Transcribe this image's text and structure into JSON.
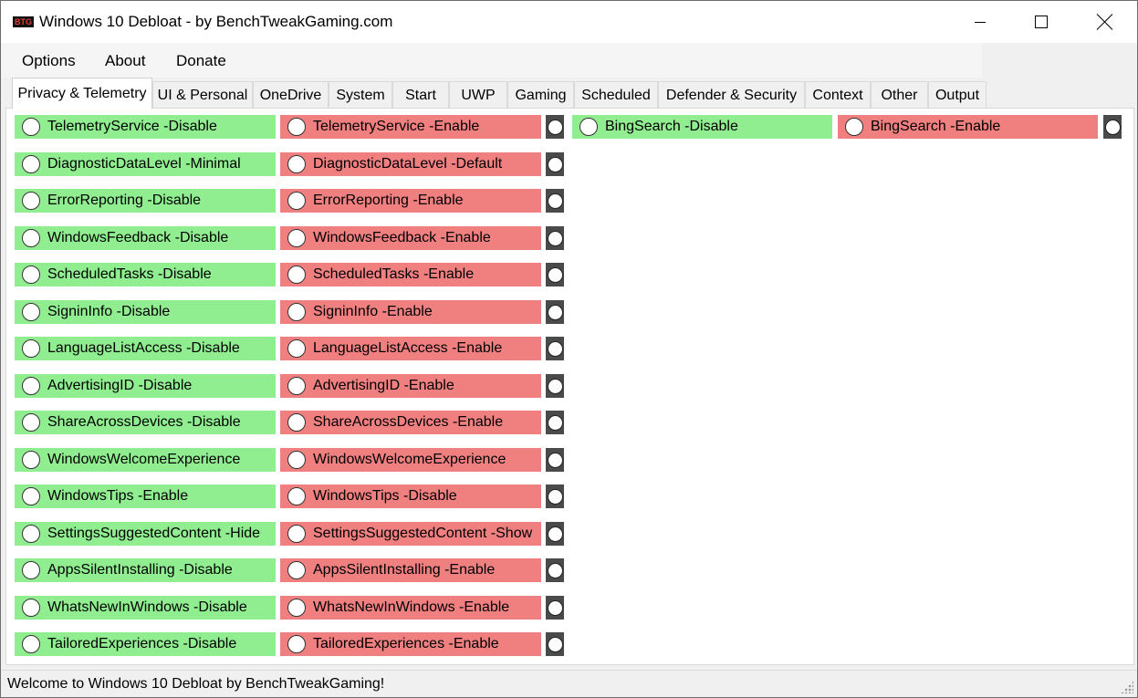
{
  "window": {
    "logo_text": "BTG",
    "title": "Windows 10 Debloat - by BenchTweakGaming.com"
  },
  "menu": {
    "items": [
      "Options",
      "About",
      "Donate"
    ]
  },
  "tabs": [
    {
      "label": "Privacy & Telemetry",
      "active": true
    },
    {
      "label": "UI & Personal",
      "active": false
    },
    {
      "label": "OneDrive",
      "active": false
    },
    {
      "label": "System",
      "active": false
    },
    {
      "label": "Start",
      "active": false
    },
    {
      "label": "UWP",
      "active": false
    },
    {
      "label": "Gaming",
      "active": false
    },
    {
      "label": "Scheduled",
      "active": false
    },
    {
      "label": "Defender & Security",
      "active": false
    },
    {
      "label": "Context",
      "active": false
    },
    {
      "label": "Other",
      "active": false
    },
    {
      "label": "Output",
      "active": false
    }
  ],
  "tweaks": [
    {
      "on": "TelemetryService -Disable",
      "off": "TelemetryService -Enable"
    },
    {
      "on": "DiagnosticDataLevel -Minimal",
      "off": "DiagnosticDataLevel -Default"
    },
    {
      "on": "ErrorReporting -Disable",
      "off": "ErrorReporting -Enable"
    },
    {
      "on": "WindowsFeedback -Disable",
      "off": "WindowsFeedback -Enable"
    },
    {
      "on": "ScheduledTasks -Disable",
      "off": "ScheduledTasks -Enable"
    },
    {
      "on": "SigninInfo -Disable",
      "off": "SigninInfo -Enable"
    },
    {
      "on": "LanguageListAccess -Disable",
      "off": "LanguageListAccess -Enable"
    },
    {
      "on": "AdvertisingID -Disable",
      "off": "AdvertisingID -Enable"
    },
    {
      "on": "ShareAcrossDevices -Disable",
      "off": "ShareAcrossDevices -Enable"
    },
    {
      "on": "WindowsWelcomeExperience",
      "off": "WindowsWelcomeExperience"
    },
    {
      "on": "WindowsTips -Enable",
      "off": "WindowsTips -Disable"
    },
    {
      "on": "SettingsSuggestedContent -Hide",
      "off": "SettingsSuggestedContent -Show"
    },
    {
      "on": "AppsSilentInstalling -Disable",
      "off": "AppsSilentInstalling -Enable"
    },
    {
      "on": "WhatsNewInWindows -Disable",
      "off": "WhatsNewInWindows -Enable"
    },
    {
      "on": "TailoredExperiences -Disable",
      "off": "TailoredExperiences -Enable"
    }
  ],
  "extra_tweak": {
    "on": "BingSearch -Disable",
    "off": "BingSearch -Enable"
  },
  "status": {
    "text": "Welcome to Windows 10 Debloat by BenchTweakGaming!"
  },
  "colors": {
    "enable_green": "#90ee90",
    "disable_red": "#f08080"
  }
}
